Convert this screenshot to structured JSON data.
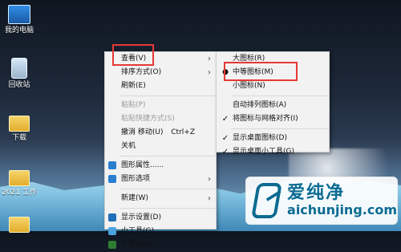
{
  "desktop": {
    "icons": [
      {
        "label": "我的电脑",
        "icon": "computer-icon"
      },
      {
        "label": "回收站",
        "icon": "recycle-bin-icon"
      },
      {
        "label": "下载",
        "icon": "folder-icon"
      },
      {
        "label": "2021 工作",
        "icon": "folder-icon"
      }
    ]
  },
  "context_menu": {
    "items": [
      {
        "label": "查看(V)",
        "has_submenu": true,
        "disabled": false
      },
      {
        "label": "排序方式(O)",
        "has_submenu": true,
        "disabled": false
      },
      {
        "label": "刷新(E)",
        "has_submenu": false,
        "disabled": false
      },
      {
        "label": "粘贴(P)",
        "has_submenu": false,
        "disabled": true
      },
      {
        "label": "粘贴快捷方式(S)",
        "has_submenu": false,
        "disabled": true
      },
      {
        "label": "撤消 移动(U)",
        "shortcut": "Ctrl+Z",
        "has_submenu": false,
        "disabled": false
      },
      {
        "label": "关机",
        "has_submenu": false,
        "disabled": false
      },
      {
        "label": "图形属性......",
        "has_submenu": false,
        "disabled": false,
        "icon": "graphics-icon"
      },
      {
        "label": "图形选项",
        "has_submenu": true,
        "disabled": false,
        "icon": "graphics-icon"
      },
      {
        "label": "新建(W)",
        "has_submenu": true,
        "disabled": false
      },
      {
        "label": "显示设置(D)",
        "has_submenu": false,
        "disabled": false,
        "icon": "display-icon"
      },
      {
        "label": "小工具(G)",
        "has_submenu": false,
        "disabled": false,
        "icon": "gadgets-icon"
      },
      {
        "label": "个性化(R)",
        "has_submenu": false,
        "disabled": false,
        "icon": "personalize-icon"
      }
    ]
  },
  "view_submenu": {
    "items": [
      {
        "label": "大图标(R)",
        "marker": ""
      },
      {
        "label": "中等图标(M)",
        "marker": "bullet"
      },
      {
        "label": "小图标(N)",
        "marker": ""
      },
      {
        "label": "自动排列图标(A)",
        "marker": ""
      },
      {
        "label": "将图标与网格对齐(I)",
        "marker": "check"
      },
      {
        "label": "显示桌面图标(D)",
        "marker": "check"
      },
      {
        "label": "显示桌面小工具(G)",
        "marker": "check"
      }
    ]
  },
  "watermark": {
    "cn": "爱纯净",
    "url": "aichunjing.com",
    "brand_color": "#0b6b92"
  },
  "colors": {
    "highlight": "#e53935",
    "menu_bg": "#f2f2f2"
  }
}
